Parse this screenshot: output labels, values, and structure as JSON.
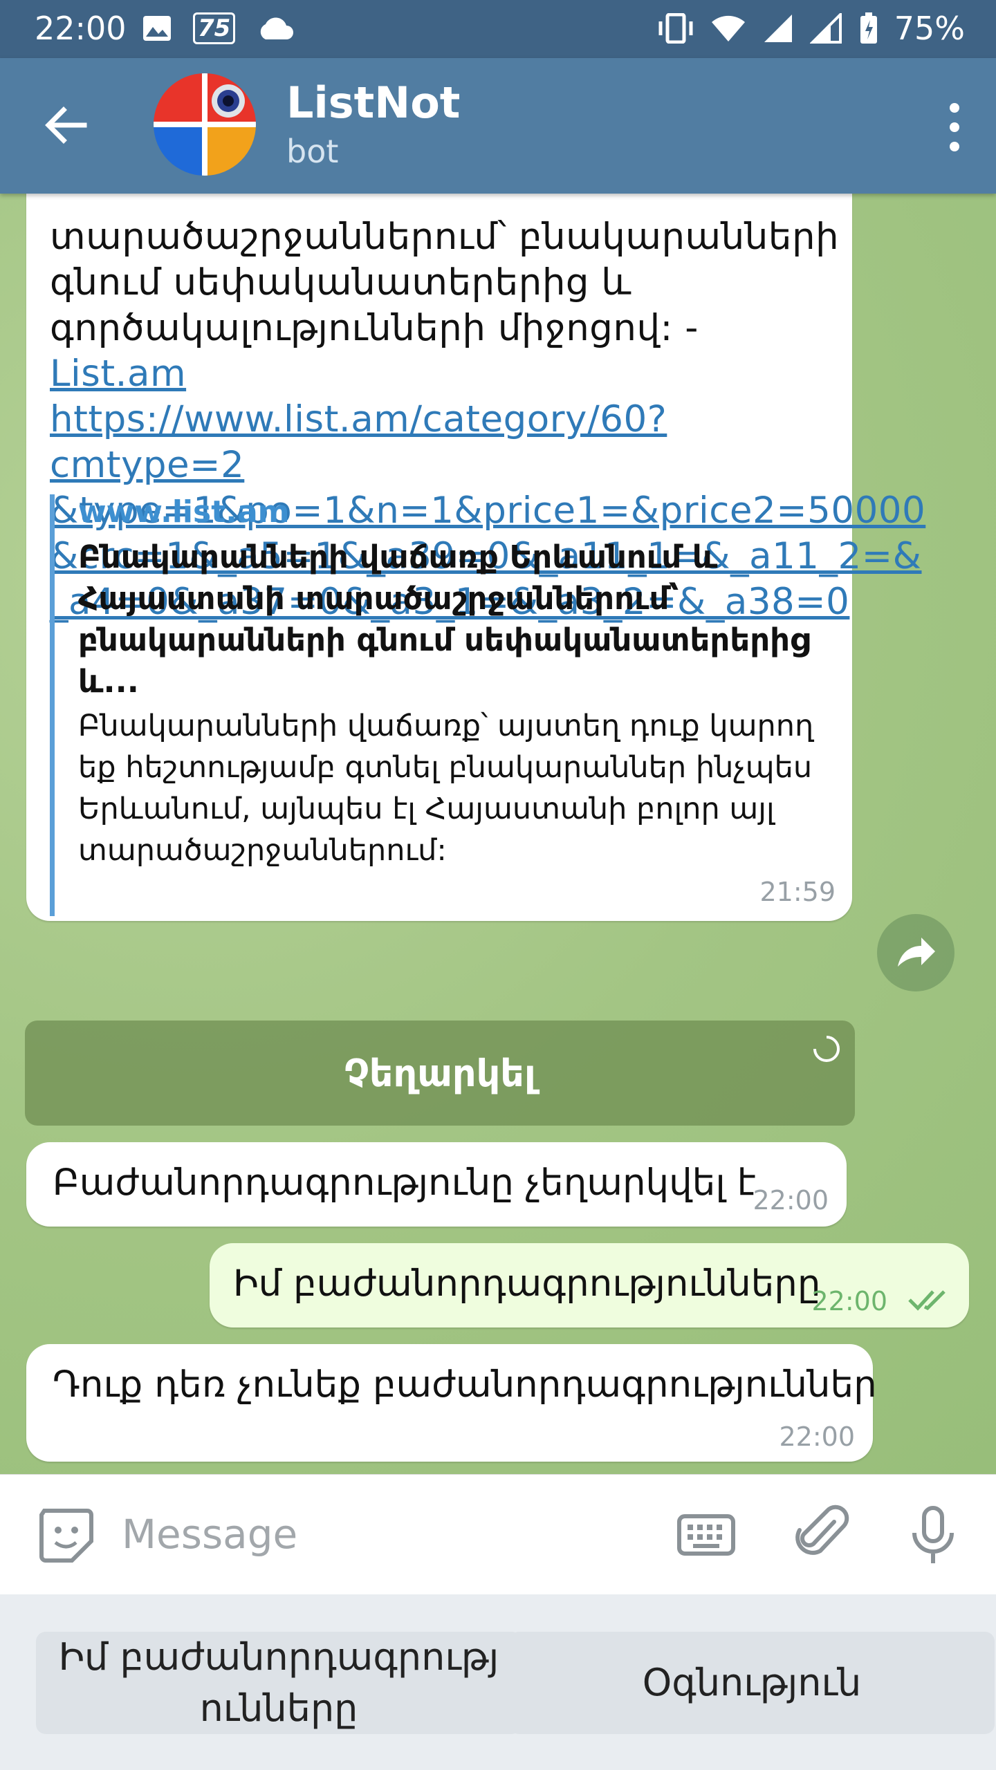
{
  "status": {
    "time": "22:00",
    "notif_badge": "75",
    "battery": "75%"
  },
  "header": {
    "title": "ListNot",
    "subtitle": "bot"
  },
  "message1": {
    "text_before": "տարածաշրջաններում՝ բնակարանների\nգնում սեփականատերերից և\nգործակալությունների միջոցով: - ",
    "link_short": "List.am",
    "link_full": "https://www.list.am/category/60?cmtype=2\n&type=1&po=1&n=1&price1=&price2=50000\n&crc=1&_a5=1&_a39=0&_a11_1=&_a11_2=&\n_a4=0&_a37=0&_a3_1=&_a3_2=&_a38=0",
    "preview_site": "www.list.am",
    "preview_title": "Բնակարանների վաճառք Երևանում և Հայաստանի տարածաշրջաններում՝ բնակարանների գնում սեփականատերերից և...",
    "preview_desc": "Բնակարանների վաճառք՝ այստեղ դուք կարող եք հեշտությամբ գտնել բնակարաններ ինչպես Երևանում, այնպես էլ Հայաստանի բոլոր այլ տարածաշրջաններում:",
    "time": "21:59"
  },
  "inline_button": {
    "label": "Չեղարկել"
  },
  "message2": {
    "text": "Բաժանորդագրությունը չեղարկվել է",
    "time": "22:00"
  },
  "message3": {
    "text": "Իմ բաժանորդագրությունները",
    "time": "22:00"
  },
  "message4": {
    "text": "Դուք դեռ չունեք բաժանորդագրություններ",
    "time": "22:00"
  },
  "input": {
    "placeholder": "Message"
  },
  "keyboard": {
    "buttons": [
      "Իմ բաժանորդագրությ\nունները",
      "Օգնություն"
    ]
  },
  "colors": {
    "header": "#517da2",
    "statusbar": "#3f6385",
    "link": "#2f7ab8",
    "outgoing": "#effdde"
  }
}
